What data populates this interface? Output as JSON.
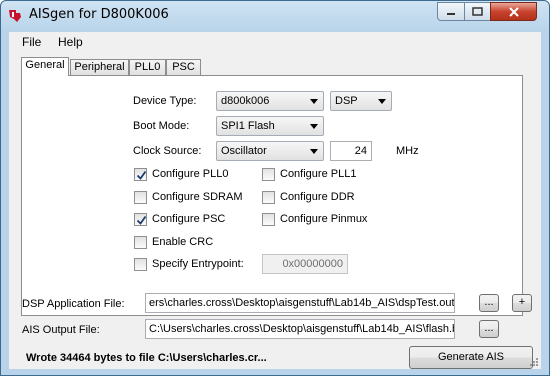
{
  "window": {
    "title": "AISgen for D800K006",
    "controls": {
      "minimize_icon": "minimize-icon",
      "maximize_icon": "maximize-icon",
      "close_icon": "close-icon"
    }
  },
  "menu": {
    "items": [
      "File",
      "Help"
    ]
  },
  "tabs": [
    {
      "label": "General",
      "active": true
    },
    {
      "label": "Peripheral",
      "active": false
    },
    {
      "label": "PLL0",
      "active": false
    },
    {
      "label": "PSC",
      "active": false
    }
  ],
  "general": {
    "device_type": {
      "label": "Device Type:",
      "value": "d800k006",
      "core": "DSP"
    },
    "boot_mode": {
      "label": "Boot Mode:",
      "value": "SPI1 Flash"
    },
    "clock_source": {
      "label": "Clock Source:",
      "value": "Oscillator",
      "frequency": "24",
      "unit": "MHz"
    },
    "checkboxes": {
      "configure_pll0": {
        "label": "Configure PLL0",
        "checked": true
      },
      "configure_pll1": {
        "label": "Configure PLL1",
        "checked": false
      },
      "configure_sdram": {
        "label": "Configure SDRAM",
        "checked": false
      },
      "configure_ddr": {
        "label": "Configure DDR",
        "checked": false
      },
      "configure_psc": {
        "label": "Configure PSC",
        "checked": true
      },
      "configure_pinmux": {
        "label": "Configure Pinmux",
        "checked": false
      },
      "enable_crc": {
        "label": "Enable CRC",
        "checked": false
      },
      "specify_entrypoint": {
        "label": "Specify Entrypoint:",
        "checked": false
      }
    },
    "entrypoint_value": "0x00000000"
  },
  "files": {
    "dsp_app": {
      "label": "DSP Application File:",
      "value": "ers\\charles.cross\\Desktop\\aisgenstuff\\Lab14b_AIS\\dspTest.out",
      "browse": "...",
      "add": "+"
    },
    "ais_output": {
      "label": "AIS Output File:",
      "value": "C:\\Users\\charles.cross\\Desktop\\aisgenstuff\\Lab14b_AIS\\flash.b",
      "browse": "..."
    }
  },
  "status_text": "Wrote 34464 bytes to file C:\\Users\\charles.cr...",
  "generate_button": "Generate AIS"
}
